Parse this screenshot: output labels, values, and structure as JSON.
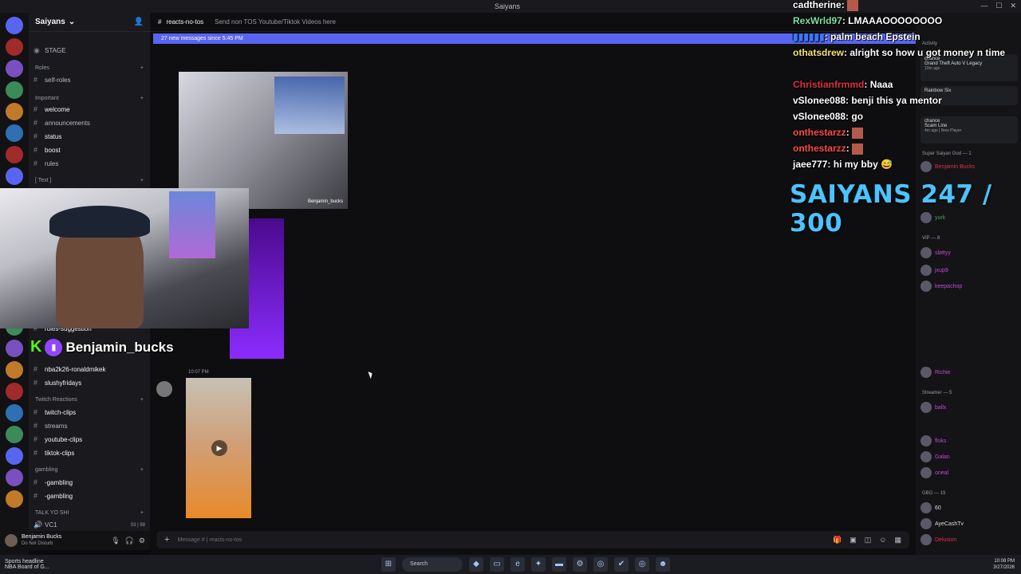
{
  "window": {
    "title": "Saiyans"
  },
  "server": {
    "name": "Saiyans"
  },
  "sidebar": {
    "stage_label": "STAGE",
    "categories": {
      "roles": "Roles",
      "important": "Important",
      "text": "[ Text ]",
      "twitch_reactions": "Twitch Reactions",
      "gambling": "gambling",
      "talk": "TALK YO SHI"
    },
    "channels": {
      "self_roles": "self-roles",
      "welcome": "welcome",
      "announcements": "announcements",
      "status": "status",
      "boost": "boost",
      "rules": "rules",
      "roles_suggestion": "roles-suggestion",
      "nba2k26": "nba2k26-ronaldmikek",
      "slushyfridays": "slushyfridays",
      "twitch_clips": "twitch-clips",
      "streams": "streams",
      "youtube_clips": "youtube-clips",
      "tiktok_clips": "tiktok-clips",
      "gambling1": "-gambling",
      "gambling2": "-gambling",
      "vc1": "VC1",
      "vc1_count": "03 | 99"
    }
  },
  "user_panel": {
    "username": "Benjamin Bucks",
    "status": "Do Not Disturb"
  },
  "channel": {
    "name": "reacts-no-tos",
    "topic": "Send non TOS Youtube/Tiktok Videos here",
    "new_messages": "27 new messages since 5:45 PM",
    "image_caption": "Benjamin_bucks",
    "message_time": "10:07 PM",
    "composer_placeholder": "Message # | reacts-no-tos"
  },
  "overlay": {
    "streamer_name": "Benjamin_bucks",
    "goal": "SAIYANS 247 / 300",
    "chat": [
      {
        "user": "cadtherine",
        "text": "",
        "color": "#ffffff",
        "emote": true
      },
      {
        "user": "RexWrld97",
        "text": "LMAAAOOOOOOOO",
        "color": "#7ee0a6",
        "emote": false
      },
      {
        "user": "",
        "text": "palm beach Epstein",
        "color": "#3a78ff",
        "emote": false
      },
      {
        "user": "othatsdrew",
        "text": "alright so how u got money n time",
        "color": "#f5e27a",
        "emote": false
      },
      {
        "user": "Christianfrmmd",
        "text": "Naaa",
        "color": "#e0304a",
        "emote": false
      },
      {
        "user": "vSlonee088",
        "text": "benji this ya mentor",
        "color": "#ffffff",
        "emote": false
      },
      {
        "user": "vSlonee088",
        "text": "go",
        "color": "#ffffff",
        "emote": false
      },
      {
        "user": "onthestarzz",
        "text": "",
        "color": "#ff4a4a",
        "emote": true
      },
      {
        "user": "onthestarzz",
        "text": "",
        "color": "#ff4a4a",
        "emote": true
      },
      {
        "user": "jaee777",
        "text": "hi my bby",
        "color": "#ffffff",
        "emote": true
      }
    ]
  },
  "members": {
    "activity_label": "Activity",
    "cards": [
      {
        "name": "chance",
        "title": "Grand Theft Auto V Legacy",
        "meta": "10m ago"
      },
      {
        "name": "",
        "title": "Rainbow Six",
        "meta": ""
      },
      {
        "name": "chance",
        "title": "Scam Line",
        "meta": "4m ago | New Player"
      }
    ],
    "groups": {
      "super": "Super Saiyan God — 1",
      "vip": "VIP — 8",
      "streamer": "Streamer — 5",
      "gbg": "GBG — 19"
    },
    "list": [
      {
        "name": "Benjamin Bucks",
        "color": "#e0304a"
      },
      {
        "name": "yurk",
        "color": "#3ba55d"
      },
      {
        "name": "slattyy",
        "color": "#c04ad6"
      },
      {
        "name": "jxup9",
        "color": "#c04ad6"
      },
      {
        "name": "keepachop",
        "color": "#c04ad6"
      },
      {
        "name": "Richie",
        "color": "#c04ad6"
      },
      {
        "name": "ballx",
        "color": "#c04ad6"
      },
      {
        "name": "floks",
        "color": "#c04ad6"
      },
      {
        "name": "Galan",
        "color": "#c04ad6"
      },
      {
        "name": "oneal",
        "color": "#c04ad6"
      },
      {
        "name": "60",
        "color": "#dbdee1"
      },
      {
        "name": "AyeCashTv",
        "color": "#dbdee1"
      },
      {
        "name": "Delusion",
        "color": "#e0304a"
      }
    ]
  },
  "taskbar": {
    "news_title": "Sports headline",
    "news_sub": "NBA Board of G...",
    "search": "Search",
    "time": "10:08 PM",
    "date": "3/27/2026"
  }
}
